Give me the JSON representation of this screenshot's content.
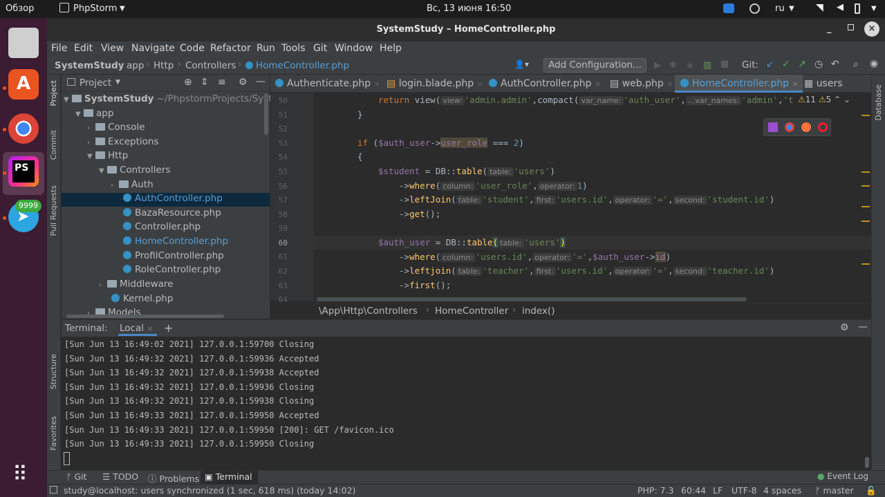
{
  "topbar": {
    "activities": "Обзор",
    "app_name": "PhpStorm",
    "datetime": "Вс, 13 июня  16:50",
    "lang": "ru"
  },
  "dock": {
    "telegram_badge": "9999"
  },
  "window": {
    "title": "SystemStudy – HomeController.php"
  },
  "menu": [
    "File",
    "Edit",
    "View",
    "Navigate",
    "Code",
    "Refactor",
    "Run",
    "Tools",
    "Git",
    "Window",
    "Help"
  ],
  "navbar": {
    "crumbs": [
      "SystemStudy",
      "app",
      "Http",
      "Controllers",
      "HomeController.php"
    ],
    "add_config": "Add Configuration...",
    "git_label": "Git:"
  },
  "project": {
    "title": "Project",
    "root": "SystemStudy",
    "root_path": "~/PhpstormProjects/Syste",
    "items": [
      "app",
      "Console",
      "Exceptions",
      "Http",
      "Controllers",
      "Auth",
      "AuthController.php",
      "BazaResource.php",
      "Controller.php",
      "HomeController.php",
      "ProfilController.php",
      "RoleController.php",
      "Middleware",
      "Kernel.php",
      "Models"
    ]
  },
  "left_strip": [
    "Project",
    "Commit",
    "Pull Requests",
    "Structure",
    "Favorites"
  ],
  "right_strip": "Database",
  "tabs": [
    "Authenticate.php",
    "login.blade.php",
    "AuthController.php",
    "web.php",
    "HomeController.php",
    "users"
  ],
  "inspections": {
    "warnings": "11",
    "weak": "5"
  },
  "editor": {
    "line_numbers": [
      "50",
      "51",
      "52",
      "53",
      "54",
      "55",
      "56",
      "57",
      "58",
      "59",
      "60",
      "61",
      "62",
      "63",
      "64"
    ],
    "hints": {
      "view": "view:",
      "var_name": "var_name:",
      "var_names": "...var_names:",
      "table": "table:",
      "column": "column:",
      "operator": "operator:",
      "first": "first:",
      "second": "second:"
    },
    "strings": {
      "admin_admin": "'admin.admin'",
      "auth_user": "'auth_user'",
      "admin": "'admin'",
      "t": "'t",
      "users": "'users'",
      "user_role": "'user_role'",
      "student": "'student'",
      "users_id": "'users.id'",
      "eq": "'='",
      "student_id": "'student.id'",
      "teacher": "'teacher'",
      "teacher_id": "'teacher.id'"
    }
  },
  "breadcrumb": [
    "\\App\\Http\\Controllers",
    "HomeController",
    "index()"
  ],
  "terminal": {
    "title": "Terminal:",
    "tab": "Local",
    "lines": [
      "[Sun Jun 13 16:49:02 2021] 127.0.0.1:59700 Closing",
      "[Sun Jun 13 16:49:32 2021] 127.0.0.1:59936 Accepted",
      "[Sun Jun 13 16:49:32 2021] 127.0.0.1:59938 Accepted",
      "[Sun Jun 13 16:49:32 2021] 127.0.0.1:59936 Closing",
      "[Sun Jun 13 16:49:32 2021] 127.0.0.1:59938 Closing",
      "[Sun Jun 13 16:49:33 2021] 127.0.0.1:59950 Accepted",
      "[Sun Jun 13 16:49:33 2021] 127.0.0.1:59950 [200]: GET /favicon.ico",
      "[Sun Jun 13 16:49:33 2021] 127.0.0.1:59950 Closing"
    ]
  },
  "bottom_tools": [
    "Git",
    "TODO",
    "Problems",
    "Terminal"
  ],
  "event_log": "Event Log",
  "status": {
    "message": "study@localhost: users synchronized (1 sec, 618 ms) (today 14:02)",
    "php": "PHP: 7.3",
    "position": "60:44",
    "line_sep": "LF",
    "encoding": "UTF-8",
    "indent": "4 spaces",
    "branch": "master"
  },
  "colors": {
    "accent": "#4a88c7",
    "background": "#2b2b2b",
    "panel": "#3c3f41",
    "selection": "#0d293e"
  }
}
